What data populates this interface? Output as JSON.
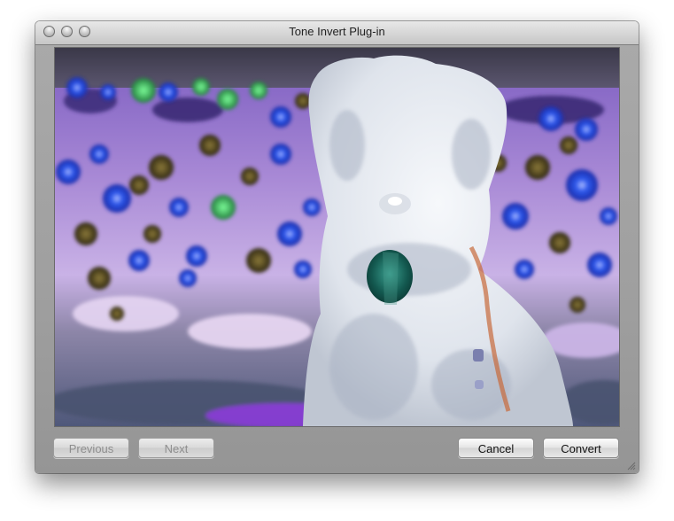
{
  "window": {
    "title": "Tone Invert Plug-in"
  },
  "buttons": {
    "previous": "Previous",
    "next": "Next",
    "cancel": "Cancel",
    "convert": "Convert"
  },
  "preview": {
    "subject": "tone-inverted photo of a dog in a flower field"
  },
  "colors": {
    "window_chrome": "#a9a9a9",
    "flower_field": "#9a7ec8",
    "flowers_blue": "#2a4fe0",
    "dog_fur": "#e8ecf2",
    "tongue": "#1f6e63"
  }
}
